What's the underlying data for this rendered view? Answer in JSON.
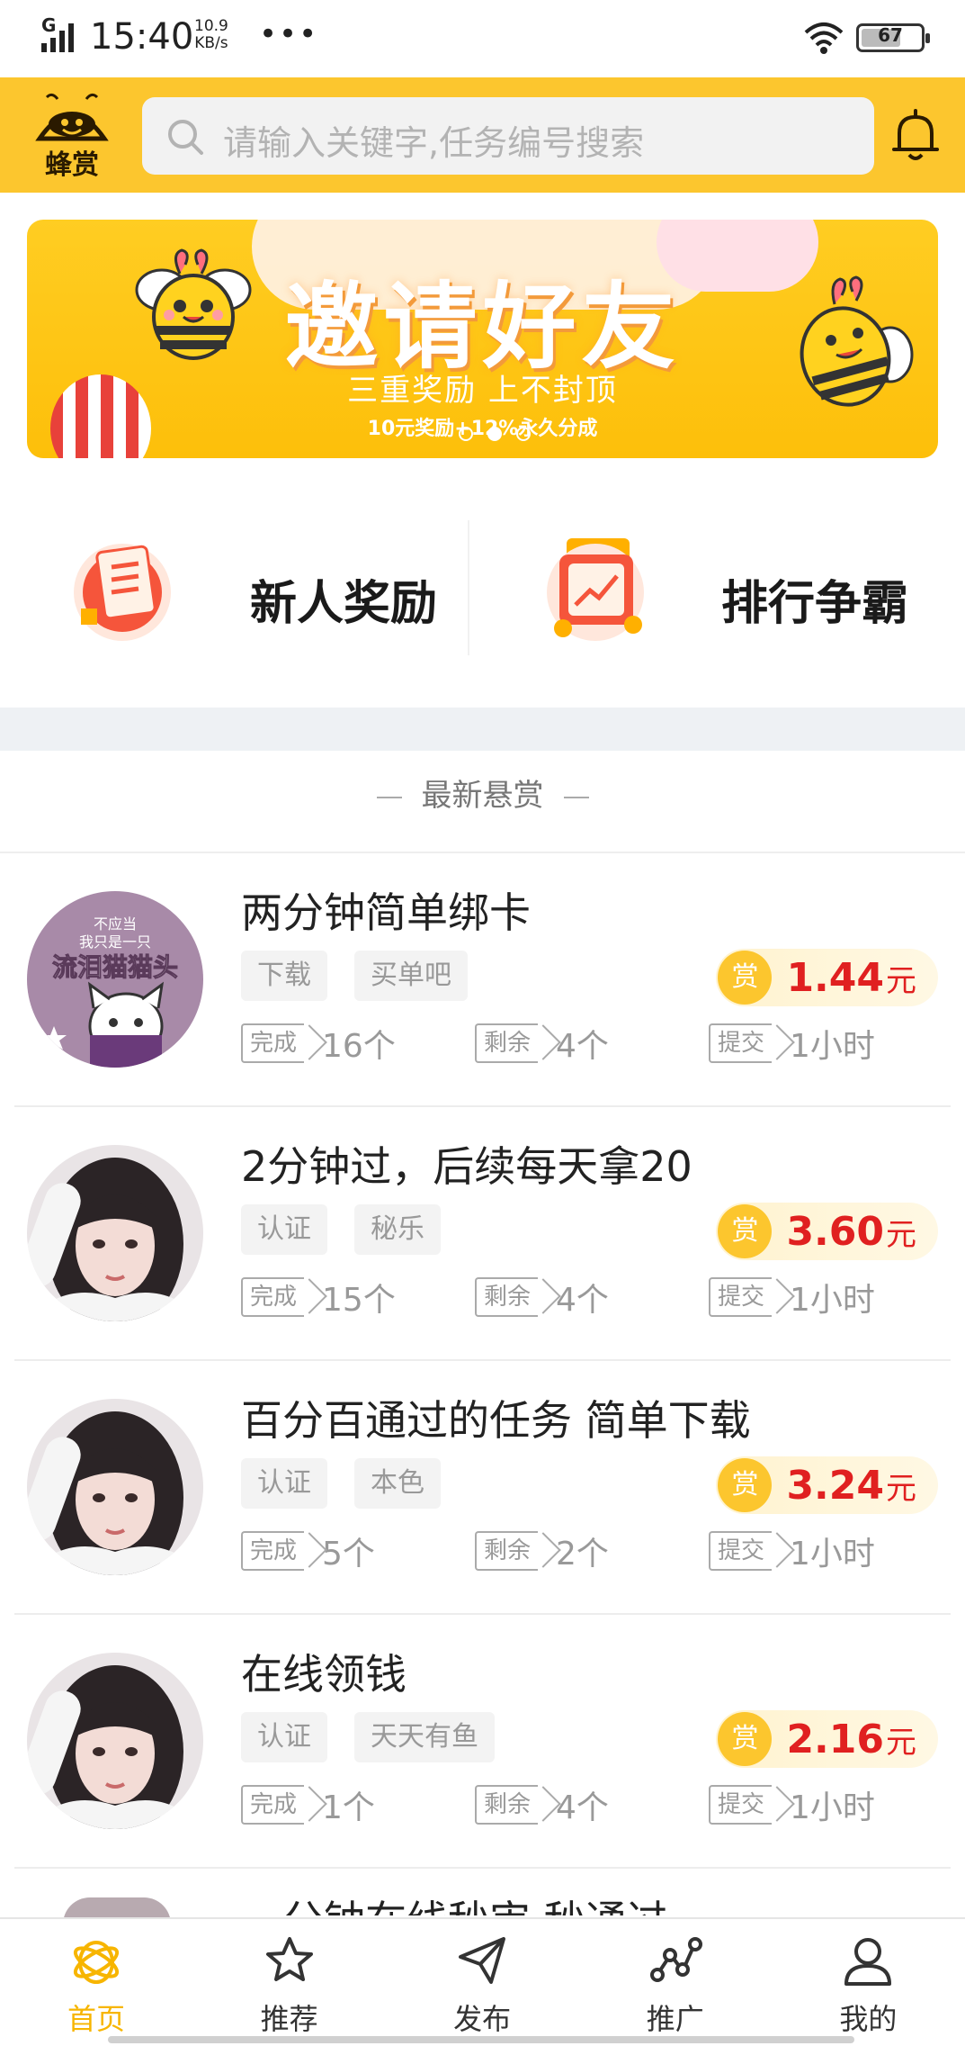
{
  "status_bar": {
    "network": "G",
    "time": "15:40",
    "speed_value": "10.9",
    "speed_unit": "KB/s",
    "more": "•••",
    "battery": "67",
    "battery_level": 0.67
  },
  "header": {
    "logo_text": "蜂赏",
    "search_placeholder": "请输入关键字,任务编号搜索",
    "bell_icon": "bell-icon",
    "color": "#fcc62e"
  },
  "banner": {
    "title": "邀请好友",
    "subtitle": "三重奖励 上不封顶",
    "subtitle2": "10元奖励+12%永久分成",
    "active_dot": 2,
    "dot_count": 3
  },
  "quick_actions": [
    {
      "label": "新人奖励",
      "icon": "document-gift-icon"
    },
    {
      "label": "排行争霸",
      "icon": "rank-chart-icon"
    }
  ],
  "section_title": "最新悬赏",
  "tasks": [
    {
      "title": "两分钟简单绑卡",
      "tags": [
        "下载",
        "买单吧"
      ],
      "reward_badge": "赏",
      "amount": "1.44",
      "unit": "元",
      "done_label": "完成",
      "done_value": "16个",
      "remain_label": "剩余",
      "remain_value": "4个",
      "submit_label": "提交",
      "submit_value": "1小时",
      "avatar_text1": "不应当",
      "avatar_text2": "我只是一只",
      "avatar_text3": "流泪猫猫头"
    },
    {
      "title": "2分钟过，后续每天拿20",
      "tags": [
        "认证",
        "秘乐"
      ],
      "reward_badge": "赏",
      "amount": "3.60",
      "unit": "元",
      "done_label": "完成",
      "done_value": "15个",
      "remain_label": "剩余",
      "remain_value": "4个",
      "submit_label": "提交",
      "submit_value": "1小时"
    },
    {
      "title": "百分百通过的任务 简单下载",
      "tags": [
        "认证",
        "本色"
      ],
      "reward_badge": "赏",
      "amount": "3.24",
      "unit": "元",
      "done_label": "完成",
      "done_value": "5个",
      "remain_label": "剩余",
      "remain_value": "2个",
      "submit_label": "提交",
      "submit_value": "1小时"
    },
    {
      "title": "在线领钱",
      "tags": [
        "认证",
        "天天有鱼"
      ],
      "reward_badge": "赏",
      "amount": "2.16",
      "unit": "元",
      "done_label": "完成",
      "done_value": "1个",
      "remain_label": "剩余",
      "remain_value": "4个",
      "submit_label": "提交",
      "submit_value": "1小时"
    }
  ],
  "partial_task_title": "一分钟在线秒审 秒通过",
  "bottom_nav": [
    {
      "label": "首页",
      "icon": "home-bee-icon",
      "active": true
    },
    {
      "label": "推荐",
      "icon": "star-icon",
      "active": false
    },
    {
      "label": "发布",
      "icon": "send-icon",
      "active": false
    },
    {
      "label": "推广",
      "icon": "share-nodes-icon",
      "active": false
    },
    {
      "label": "我的",
      "icon": "user-icon",
      "active": false
    }
  ],
  "colors": {
    "accent": "#fcc62e",
    "active_nav": "#f7b500",
    "reward_red": "#e02020"
  }
}
